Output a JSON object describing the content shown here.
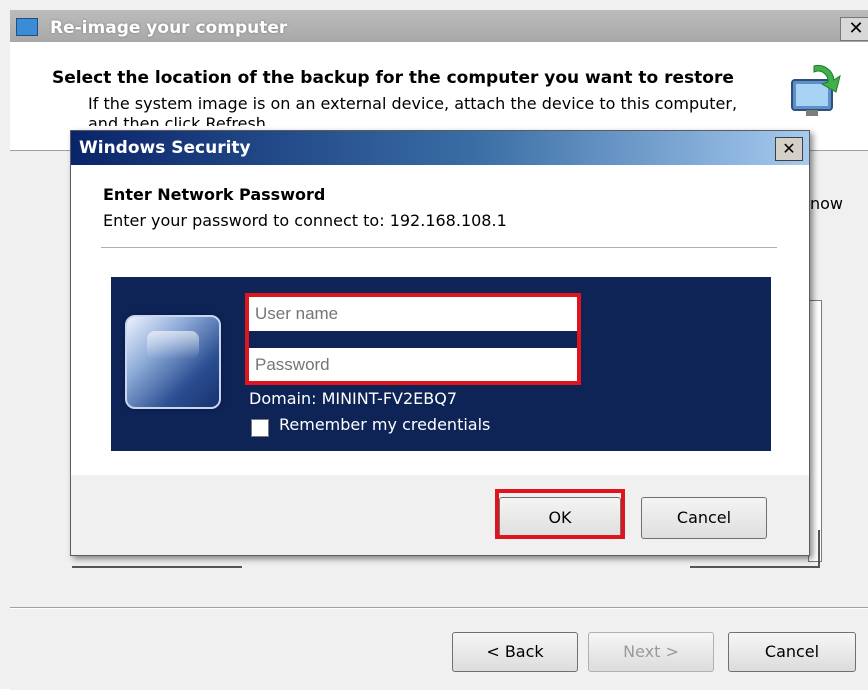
{
  "background_wizard": {
    "title": "Re-image your computer",
    "heading": "Select the location of the backup for the computer you want to restore",
    "description_line1": "If the system image is on an external device, attach the device to this computer,",
    "description_line2": "and then click Refresh.",
    "partial_text": "now",
    "buttons": {
      "back": "< Back",
      "next": "Next >",
      "cancel": "Cancel"
    },
    "close_glyph": "✕"
  },
  "dialog": {
    "title": "Windows Security",
    "close_glyph": "✕",
    "heading": "Enter Network Password",
    "subtext": "Enter your password to connect to: 192.168.108.1",
    "username_placeholder": "User name",
    "password_placeholder": "Password",
    "domain": "Domain: MININT-FV2EBQ7",
    "remember_label": "Remember my credentials",
    "remember_checked": false,
    "ok": "OK",
    "cancel": "Cancel"
  },
  "colors": {
    "credential_panel": "#0e2457",
    "highlight": "#e0141c",
    "dialog_title_gradient_start": "#0a246a"
  },
  "icons": {
    "wizard_title_icon": "backup-monitor-icon",
    "wizard_header_icon": "computer-restore-icon",
    "user_tile": "user-tile-icon"
  }
}
